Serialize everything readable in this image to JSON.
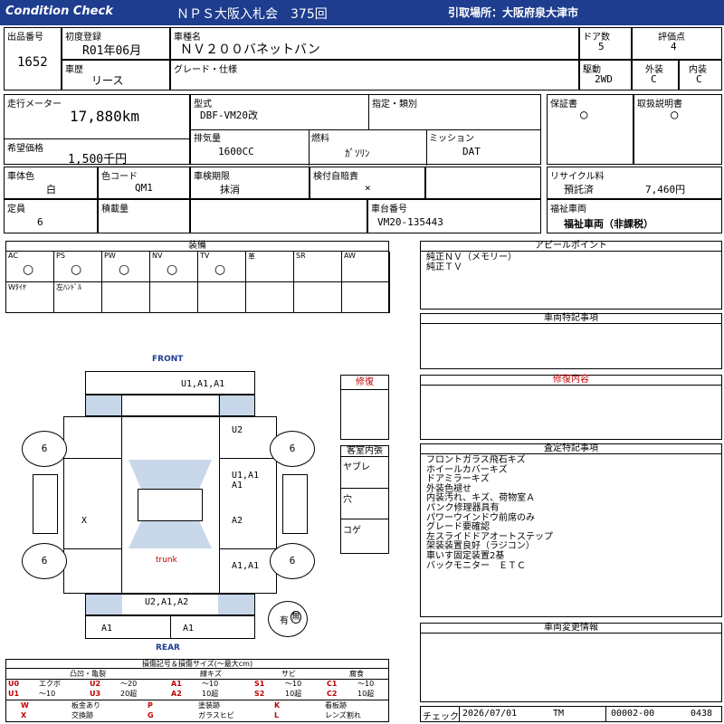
{
  "header": {
    "left": "Condition  Check",
    "center": "ＮＰＳ大阪入札会　375回",
    "right": "引取場所：大阪府泉大津市"
  },
  "info": {
    "lot_no_label": "出品番号",
    "lot_no": "1652",
    "first_reg_label": "初度登録",
    "first_reg": "R01年06月",
    "car_name_label": "車種名",
    "car_name": "ＮＶ２００バネットバン",
    "doors_label": "ドア数",
    "doors": "5",
    "rating_label": "評価点",
    "rating": "4",
    "history_label": "車歴",
    "history": "リース",
    "grade_label": "グレード・仕様",
    "grade": "",
    "drive_label": "駆動",
    "drive": "2WD",
    "exterior_label": "外装",
    "exterior": "C",
    "interior_label": "内装",
    "interior": "C",
    "mileage_label": "走行メーター",
    "mileage": "17,880km",
    "price_label": "希望価格",
    "price": "1,500千円",
    "model_label": "型式",
    "model": "DBF-VM20改",
    "designation_label": "指定・類別",
    "displacement_label": "排気量",
    "displacement": "1600CC",
    "fuel_label": "燃料",
    "fuel": "ｶﾞｿﾘﾝ",
    "mission_label": "ミッション",
    "mission": "DAT",
    "warranty_label": "保証書",
    "warranty": "○",
    "manual_label": "取扱説明書",
    "manual": "○",
    "body_color_label": "車体色",
    "body_color": "白",
    "color_code_label": "色コード",
    "color_code": "QM1",
    "inspection_label": "車検期限",
    "inspection": "抹消",
    "self_weight_label": "検付自賠責",
    "self_weight": "×",
    "recycle_label": "リサイクル料",
    "recycle_status": "預託済",
    "recycle_fee": "7,460円",
    "capacity_label": "定員",
    "capacity": "6",
    "load_label": "積載量",
    "chassis_label": "車台番号",
    "chassis": "VM20-135443",
    "welfare_label": "福祉車両",
    "welfare": "福祉車両（非課税）"
  },
  "equipment": {
    "title": "装備",
    "row1": [
      {
        "name": "AC",
        "mark": "○"
      },
      {
        "name": "PS",
        "mark": "○"
      },
      {
        "name": "PW",
        "mark": "○"
      },
      {
        "name": "NV",
        "mark": "○"
      },
      {
        "name": "TV",
        "mark": "○"
      },
      {
        "name": "革",
        "mark": ""
      },
      {
        "name": "SR",
        "mark": ""
      },
      {
        "name": "AW",
        "mark": ""
      }
    ],
    "row2": [
      "Wﾀｲﾔ",
      "左ﾊﾝﾄﾞﾙ",
      "",
      "",
      "",
      "",
      "",
      ""
    ]
  },
  "appeal": {
    "title": "アピールポイント",
    "lines": [
      "純正ＮＶ（メモリー）",
      "純正ＴＶ"
    ]
  },
  "special_notes_title": "車両特記事項",
  "repair_title": "修復",
  "repair_content_title": "修復内容",
  "inspection_notes": {
    "title": "査定特記事項",
    "lines": [
      "フロントガラス飛石キズ",
      "ホイールカバーキズ",
      "ドアミラーキズ",
      "外装色褪せ",
      "内装汚れ、キズ、荷物室Ａ",
      "パンク修理器具有",
      "パワーウインドウ前席のみ",
      "グレード要確認",
      "左スライドドアオートステップ",
      "架装装置良好（ラジコン）",
      "車いす固定装置2基",
      "バックモニター　ＥＴＣ"
    ]
  },
  "change_info_title": "車両変更情報",
  "cabin": {
    "title": "客室内張",
    "rows": [
      "ヤブレ",
      "穴",
      "コゲ"
    ]
  },
  "diagram": {
    "front": "FRONT",
    "rear": "REAR",
    "trunk": "trunk",
    "marks": {
      "top": "U1,A1,A1",
      "left_front": "U2",
      "right_upper": "U1,A1",
      "right_upper2": "A1",
      "left_mid": "X",
      "right_mid": "A2",
      "right_lower": "A1,A1",
      "bottom": "U2,A1,A2",
      "rear_left": "A1",
      "rear_right": "A1",
      "wheel_fl": "6",
      "wheel_fr": "6",
      "wheel_rl": "6",
      "wheel_rr": "6"
    },
    "seal_left": "有",
    "seal_right": "無"
  },
  "legend": {
    "title": "損傷記号＆損傷サイズ(～最大cm)",
    "headers": [
      "凸凹・亀裂",
      "線キズ",
      "サビ",
      "腐食"
    ],
    "row1": [
      [
        "U0",
        "エクボ"
      ],
      [
        "U2",
        "～20"
      ],
      [
        "A1",
        "～10"
      ],
      [
        "S1",
        "～10"
      ],
      [
        "C1",
        "～10"
      ]
    ],
    "row2": [
      [
        "U1",
        "～10"
      ],
      [
        "U3",
        "20超"
      ],
      [
        "A2",
        "10超"
      ],
      [
        "S2",
        "10超"
      ],
      [
        "C2",
        "10超"
      ]
    ],
    "row3": [
      [
        "W",
        "板金あり"
      ],
      [
        "P",
        "塗装跡"
      ],
      [
        "K",
        "看板跡"
      ]
    ],
    "row4": [
      [
        "X",
        "交換跡"
      ],
      [
        "G",
        "ガラスヒビ"
      ],
      [
        "L",
        "レンズ割れ"
      ]
    ]
  },
  "footer": {
    "check_label": "チェック",
    "date": "2026/07/01",
    "tm": "TM",
    "code1": "00002-00",
    "code2": "0438"
  }
}
